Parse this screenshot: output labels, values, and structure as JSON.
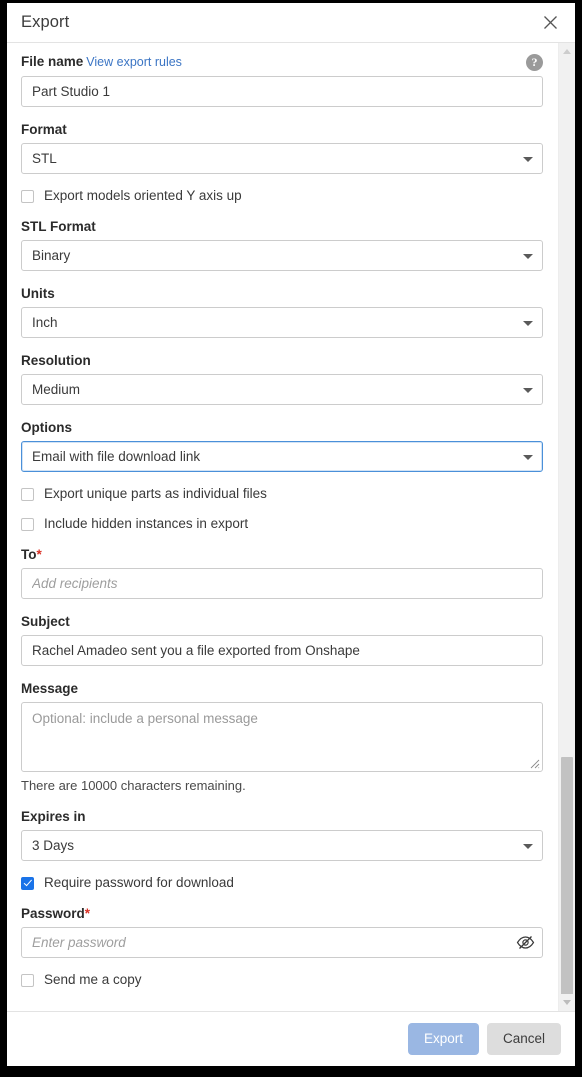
{
  "dialog": {
    "title": "Export",
    "close_icon": "close-icon"
  },
  "fields": {
    "file_name": {
      "label": "File name",
      "link": "View export rules",
      "help_icon_glyph": "?",
      "value": "Part Studio 1"
    },
    "format": {
      "label": "Format",
      "value": "STL"
    },
    "orient_y_up": {
      "label": "Export models oriented Y axis up",
      "checked": false
    },
    "stl_format": {
      "label": "STL Format",
      "value": "Binary"
    },
    "units": {
      "label": "Units",
      "value": "Inch"
    },
    "resolution": {
      "label": "Resolution",
      "value": "Medium"
    },
    "options": {
      "label": "Options",
      "value": "Email with file download link",
      "focused": true
    },
    "unique_parts": {
      "label": "Export unique parts as individual files",
      "checked": false
    },
    "hidden_instances": {
      "label": "Include hidden instances in export",
      "checked": false
    },
    "to": {
      "label": "To",
      "required_mark": "*",
      "value": "",
      "placeholder": "Add recipients"
    },
    "subject": {
      "label": "Subject",
      "value": "Rachel Amadeo sent you a file exported from Onshape"
    },
    "message": {
      "label": "Message",
      "value": "",
      "placeholder": "Optional: include a personal message",
      "counter": "There are 10000 characters remaining."
    },
    "expires_in": {
      "label": "Expires in",
      "value": "3 Days"
    },
    "require_password": {
      "label": "Require password for download",
      "checked": true
    },
    "password": {
      "label": "Password",
      "required_mark": "*",
      "value": "",
      "placeholder": "Enter password",
      "toggle_icon": "eye-off-icon"
    },
    "send_copy": {
      "label": "Send me a copy",
      "checked": false
    }
  },
  "footer": {
    "export_label": "Export",
    "cancel_label": "Cancel"
  },
  "scrollbar": {
    "up_icon": "chevron-up-icon",
    "down_icon": "chevron-down-icon"
  },
  "colors": {
    "accent": "#1a73e8",
    "link": "#3b75c4",
    "required": "#d93025",
    "primary_button": "#9ab7e3",
    "secondary_button": "#dddddd",
    "focus_border": "#4a90d9"
  }
}
